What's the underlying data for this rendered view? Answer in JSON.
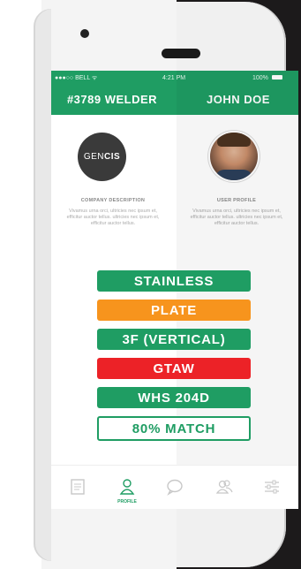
{
  "status_bar": {
    "carrier": "●●●○○ BELL ᯤ",
    "time": "4:21 PM",
    "battery": "100%"
  },
  "header": {
    "left_title": "#3789 WELDER",
    "right_title": "JOHN DOE"
  },
  "company": {
    "logo_text_regular": "GEN",
    "logo_text_bold": "CIS",
    "label": "COMPANY DESCRIPTION",
    "description": "Vivamus urna orci, ultricies nec ipsum et, efficitur auctor tellus. ultricies nec ipsum et, efficitur auctor tellus."
  },
  "user": {
    "label": "USER PROFILE",
    "description": "Vivamus urna orci, ultricies nec ipsum et, efficitur auctor tellus. ultricies nec ipsum et, efficitur auctor tellus."
  },
  "tags": [
    {
      "label": "STAINLESS",
      "color": "#1f9d63"
    },
    {
      "label": "PLATE",
      "color": "#f7941d"
    },
    {
      "label": "3F (VERTICAL)",
      "color": "#1f9d63"
    },
    {
      "label": "GTAW",
      "color": "#ec2227"
    },
    {
      "label": "WHS 204D",
      "color": "#1f9d63"
    },
    {
      "label": "80% MATCH",
      "color": "#1f9d63",
      "style": "outline"
    }
  ],
  "tabbar": {
    "active_label": "PROFILE",
    "icons": [
      "document-icon",
      "profile-icon",
      "chat-icon",
      "users-icon",
      "sliders-icon"
    ]
  },
  "colors": {
    "brand_green": "#1f9d63",
    "orange": "#f7941d",
    "red": "#ec2227"
  }
}
